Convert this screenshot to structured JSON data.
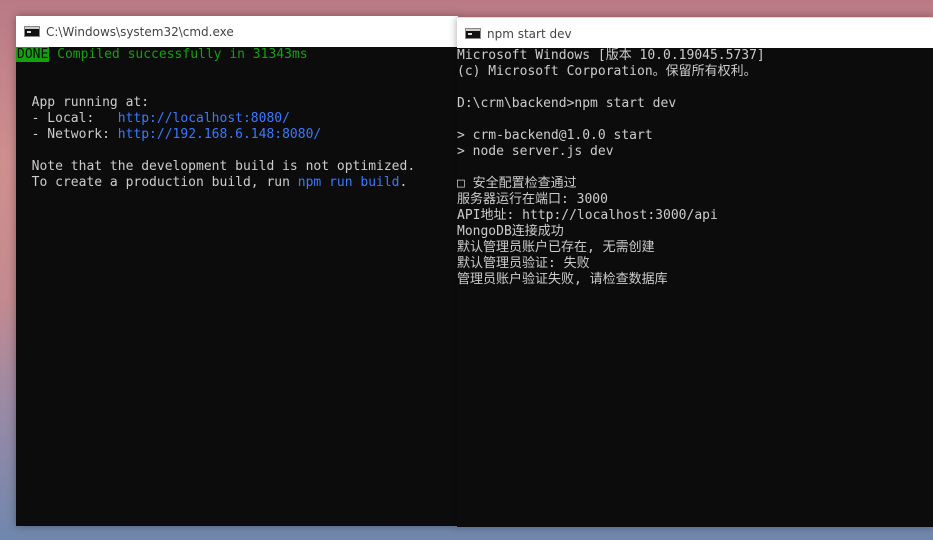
{
  "left_window": {
    "title": "C:\\Windows\\system32\\cmd.exe",
    "done_badge": "DONE",
    "compiled_msg": "Compiled successfully in 31343ms",
    "app_running": "  App running at:",
    "local_label": "  - Local:   ",
    "local_url": "http://localhost:8080/",
    "network_label": "  - Network: ",
    "network_url": "http://192.168.6.148:8080/",
    "note_line": "  Note that the development build is not optimized.",
    "prod_prefix": "  To create a production build, run ",
    "prod_cmd": "npm run build",
    "prod_suffix": "."
  },
  "right_window": {
    "title": "npm start dev",
    "lines": {
      "l1": "Microsoft Windows [版本 10.0.19045.5737]",
      "l2": "(c) Microsoft Corporation。保留所有权利。",
      "l3": "D:\\crm\\backend>npm start dev",
      "l4": "> crm-backend@1.0.0 start",
      "l5": "> node server.js dev",
      "l6": "□ 安全配置检查通过",
      "l7": "服务器运行在端口: 3000",
      "l8": "API地址: http://localhost:3000/api",
      "l9": "MongoDB连接成功",
      "l10": "默认管理员账户已存在, 无需创建",
      "l11": "默认管理员验证: 失败",
      "l12": "管理员账户验证失败, 请检查数据库"
    }
  },
  "colors": {
    "console_bg": "#0c0c0c",
    "console_fg": "#cccccc",
    "green": "#13a10e",
    "link_blue": "#3b78ff"
  }
}
